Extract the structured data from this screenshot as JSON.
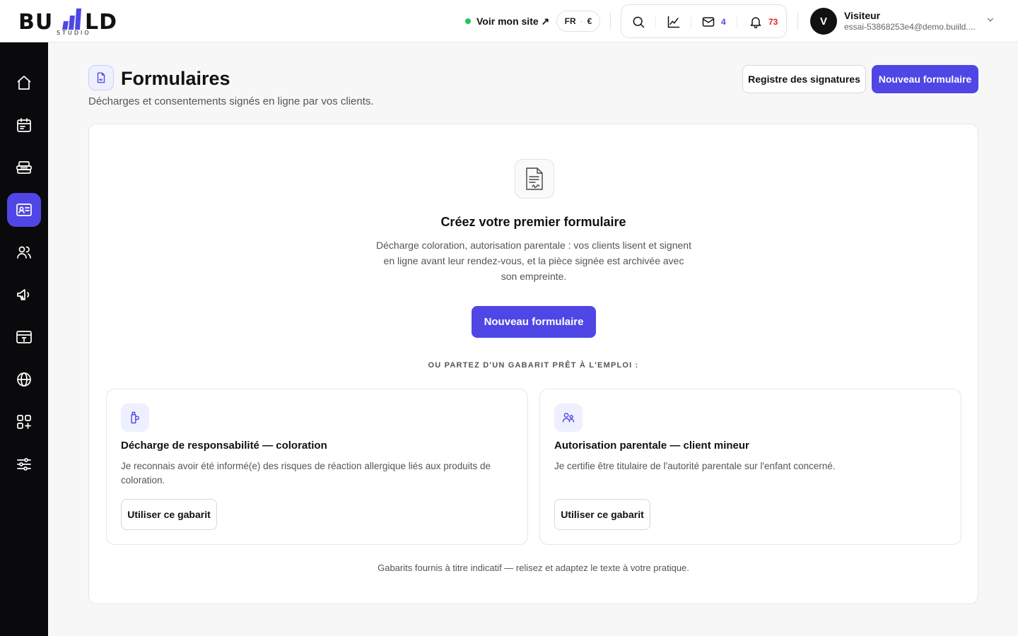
{
  "brand": {
    "word_left": "BU",
    "word_right": "LD",
    "tagline": "STUDIO",
    "accent": "#4f46e5"
  },
  "topbar": {
    "site_link_label": "Voir mon site ↗",
    "site_status_color": "#22c55e",
    "lang": "FR",
    "lang_sep": "·",
    "currency": "€",
    "messages_count": "4",
    "notifications_count": "73",
    "tools": [
      "search-icon",
      "chart-icon",
      "mail-icon",
      "bell-icon"
    ]
  },
  "user": {
    "initial": "V",
    "name": "Visiteur",
    "email": "essai-53868253e4@demo.buiild...."
  },
  "sidebar": {
    "items": [
      {
        "icon": "home-icon",
        "active": false
      },
      {
        "icon": "calendar-icon",
        "active": false
      },
      {
        "icon": "register-icon",
        "active": false
      },
      {
        "icon": "id-card-icon",
        "active": true
      },
      {
        "icon": "users-icon",
        "active": false
      },
      {
        "icon": "megaphone-icon",
        "active": false
      },
      {
        "icon": "payment-icon",
        "active": false
      },
      {
        "icon": "globe-icon",
        "active": false
      },
      {
        "icon": "apps-add-icon",
        "active": false
      },
      {
        "icon": "sliders-icon",
        "active": false
      }
    ]
  },
  "page": {
    "title": "Formulaires",
    "subtitle": "Décharges et consentements signés en ligne par vos clients.",
    "signatures_button": "Registre des signatures",
    "new_button": "Nouveau formulaire"
  },
  "empty_state": {
    "title": "Créez votre premier formulaire",
    "description": "Décharge coloration, autorisation parentale : vos clients lisent et signent en ligne avant leur rendez-vous, et la pièce signée est archivée avec son empreinte.",
    "button": "Nouveau formulaire",
    "or_label": "OU PARTEZ D'UN GABARIT PRÊT À L'EMPLOI :"
  },
  "templates": [
    {
      "icon": "dye-bottle-icon",
      "title": "Décharge de responsabilité — coloration",
      "description": "Je reconnais avoir été informé(e) des risques de réaction allergique liés aux produits de coloration.",
      "button": "Utiliser ce gabarit"
    },
    {
      "icon": "parent-child-icon",
      "title": "Autorisation parentale — client mineur",
      "description": "Je certifie être titulaire de l'autorité parentale sur l'enfant concerné.",
      "button": "Utiliser ce gabarit"
    }
  ],
  "footer_note": "Gabarits fournis à titre indicatif — relisez et adaptez le texte à votre pratique."
}
